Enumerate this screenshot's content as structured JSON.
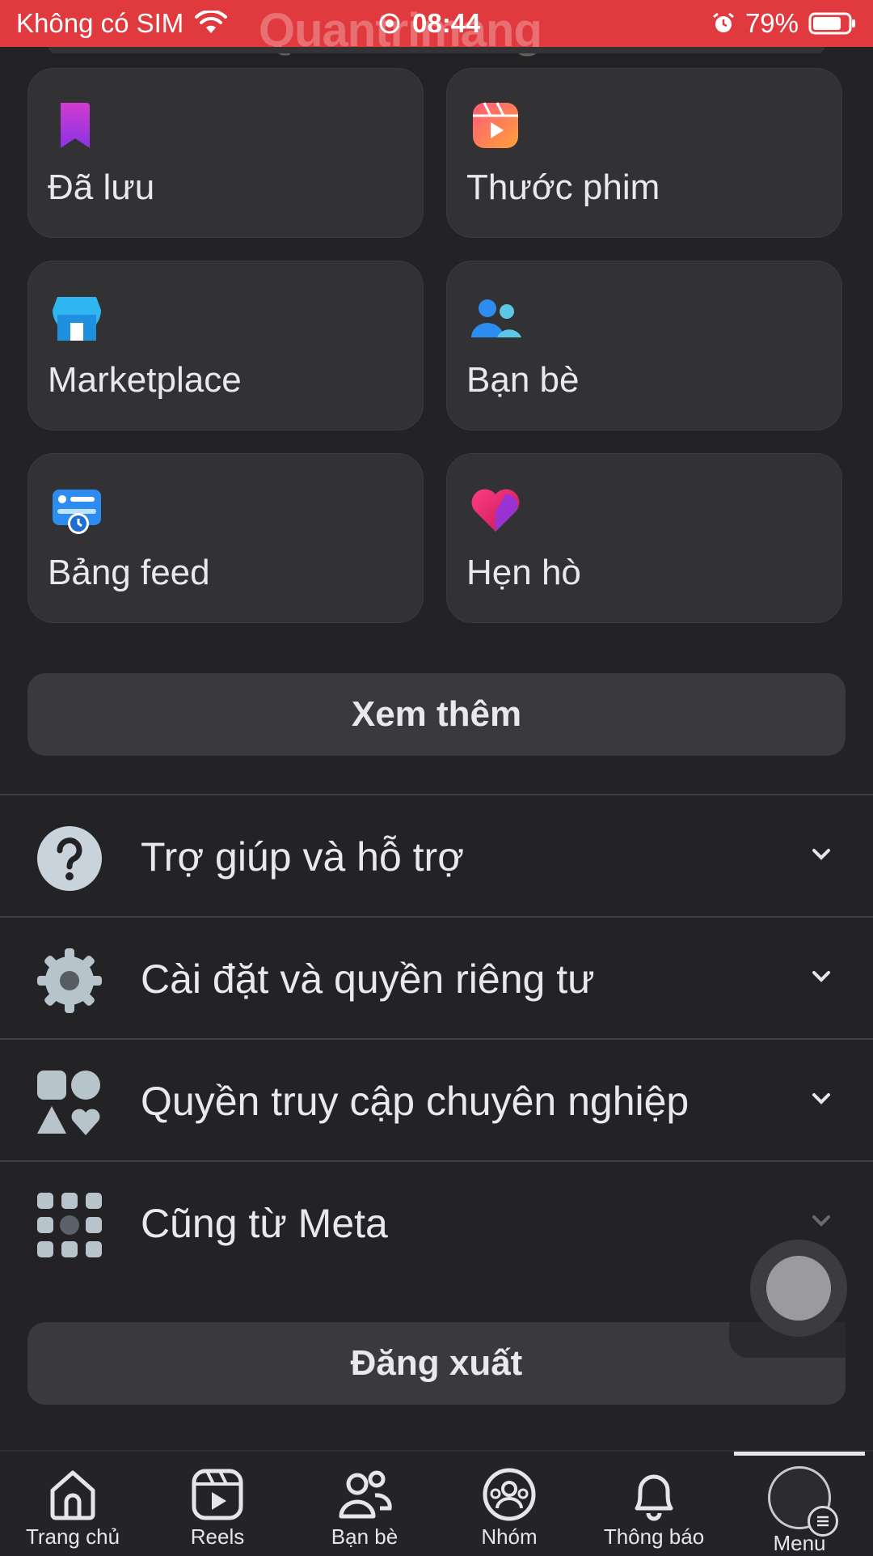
{
  "status_bar": {
    "carrier": "Không có SIM",
    "time": "08:44",
    "battery": "79%",
    "watermark": "Quantrimang"
  },
  "shortcuts": [
    {
      "label": "Đã lưu",
      "icon": "bookmark-icon"
    },
    {
      "label": "Thước phim",
      "icon": "reels-icon"
    },
    {
      "label": "Marketplace",
      "icon": "marketplace-icon"
    },
    {
      "label": "Bạn bè",
      "icon": "friends-icon"
    },
    {
      "label": "Bảng feed",
      "icon": "feeds-icon"
    },
    {
      "label": "Hẹn hò",
      "icon": "dating-heart-icon"
    }
  ],
  "see_more_label": "Xem thêm",
  "sections": [
    {
      "label": "Trợ giúp và hỗ trợ",
      "icon": "help-icon"
    },
    {
      "label": "Cài đặt và quyền riêng tư",
      "icon": "gear-icon"
    },
    {
      "label": "Quyền truy cập chuyên nghiệp",
      "icon": "professional-access-icon"
    },
    {
      "label": "Cũng từ Meta",
      "icon": "apps-grid-icon"
    }
  ],
  "logout_label": "Đăng xuất",
  "bottom_nav": [
    {
      "label": "Trang chủ",
      "icon": "home-icon"
    },
    {
      "label": "Reels",
      "icon": "reels-icon"
    },
    {
      "label": "Bạn bè",
      "icon": "friends-icon"
    },
    {
      "label": "Nhóm",
      "icon": "groups-icon"
    },
    {
      "label": "Thông báo",
      "icon": "bell-icon"
    },
    {
      "label": "Menu",
      "icon": "avatar-menu-icon",
      "active": true
    }
  ],
  "colors": {
    "status_bar": "#e0393e",
    "background": "#232325",
    "card": "#323234"
  }
}
